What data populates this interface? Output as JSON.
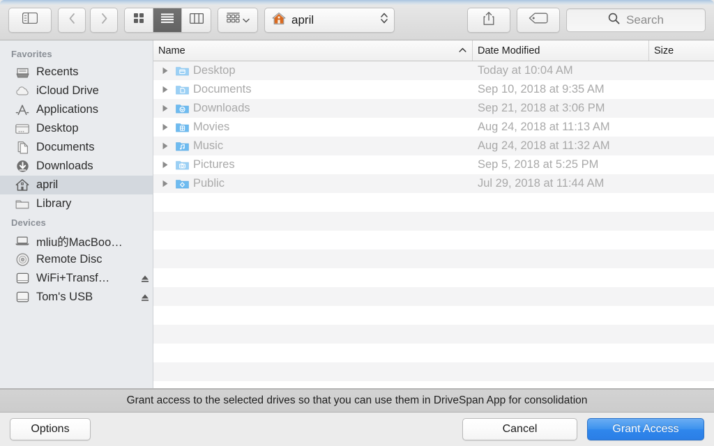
{
  "toolbar": {
    "sidebar_toggle": "sidebar-toggle",
    "back_label": "Back",
    "forward_label": "Forward",
    "view_icon_label": "Icon View",
    "view_list_label": "List View",
    "view_column_label": "Column View",
    "arrange_label": "Arrange By",
    "path_label": "april",
    "share_label": "Share",
    "tag_label": "Tags",
    "search_placeholder": "Search"
  },
  "sidebar": {
    "sections": [
      {
        "title": "Favorites",
        "items": [
          {
            "label": "Recents",
            "icon": "recents-icon",
            "selected": false,
            "eject": false
          },
          {
            "label": "iCloud Drive",
            "icon": "icloud-icon",
            "selected": false,
            "eject": false
          },
          {
            "label": "Applications",
            "icon": "applications-icon",
            "selected": false,
            "eject": false
          },
          {
            "label": "Desktop",
            "icon": "desktop-icon",
            "selected": false,
            "eject": false
          },
          {
            "label": "Documents",
            "icon": "documents-icon",
            "selected": false,
            "eject": false
          },
          {
            "label": "Downloads",
            "icon": "downloads-icon",
            "selected": false,
            "eject": false
          },
          {
            "label": "april",
            "icon": "home-icon",
            "selected": true,
            "eject": false
          },
          {
            "label": "Library",
            "icon": "folder-icon",
            "selected": false,
            "eject": false
          }
        ]
      },
      {
        "title": "Devices",
        "items": [
          {
            "label": "mliu的MacBoo…",
            "icon": "laptop-icon",
            "selected": false,
            "eject": false
          },
          {
            "label": "Remote Disc",
            "icon": "disc-icon",
            "selected": false,
            "eject": false
          },
          {
            "label": "WiFi+Transf…",
            "icon": "external-drive-icon",
            "selected": false,
            "eject": true
          },
          {
            "label": "Tom's USB",
            "icon": "external-drive-icon",
            "selected": false,
            "eject": true
          }
        ]
      }
    ]
  },
  "file_list": {
    "columns": {
      "name": "Name",
      "date_modified": "Date Modified",
      "size": "Size",
      "sort_indicator": "▲"
    },
    "rows": [
      {
        "name": "Desktop",
        "icon": "folder-desktop-icon",
        "date": "Today at 10:04 AM",
        "size": ""
      },
      {
        "name": "Documents",
        "icon": "folder-documents-icon",
        "date": "Sep 10, 2018 at 9:35 AM",
        "size": ""
      },
      {
        "name": "Downloads",
        "icon": "folder-downloads-icon",
        "date": "Sep 21, 2018 at 3:06 PM",
        "size": ""
      },
      {
        "name": "Movies",
        "icon": "folder-movies-icon",
        "date": "Aug 24, 2018 at 11:13 AM",
        "size": ""
      },
      {
        "name": "Music",
        "icon": "folder-music-icon",
        "date": "Aug 24, 2018 at 11:32 AM",
        "size": ""
      },
      {
        "name": "Pictures",
        "icon": "folder-pictures-icon",
        "date": "Sep 5, 2018 at 5:25 PM",
        "size": ""
      },
      {
        "name": "Public",
        "icon": "folder-public-icon",
        "date": "Jul 29, 2018 at 11:44 AM",
        "size": ""
      }
    ]
  },
  "footer": {
    "message": "Grant access to the selected drives so that you can use them in DriveSpan App for consolidation",
    "options_label": "Options",
    "cancel_label": "Cancel",
    "grant_label": "Grant Access"
  },
  "colors": {
    "accent": "#2f87ec",
    "sidebar_selection": "#d3d8de",
    "row_alt": "#f4f4f5",
    "message_bar": "#cfcfcf"
  }
}
